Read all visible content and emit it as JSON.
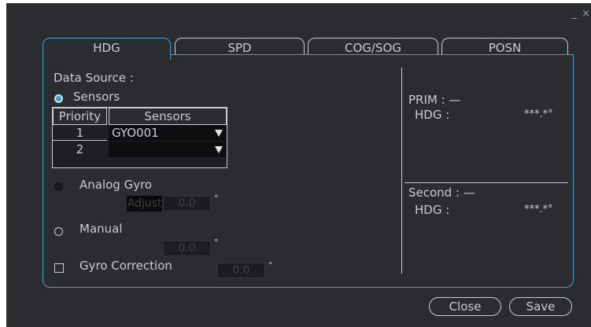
{
  "window": {
    "controls": "_ ×"
  },
  "tabs": [
    {
      "label": "HDG",
      "active": true
    },
    {
      "label": "SPD",
      "active": false
    },
    {
      "label": "COG/SOG",
      "active": false
    },
    {
      "label": "POSN",
      "active": false
    }
  ],
  "data_source": {
    "label": "Data Source :",
    "sensors_option": "Sensors",
    "sensors_selected": true,
    "table": {
      "headers": [
        "Priority",
        "Sensors"
      ],
      "rows": [
        {
          "priority": "1",
          "sensor": "GYO001"
        },
        {
          "priority": "2",
          "sensor": ""
        }
      ]
    },
    "analog_gyro": {
      "label": "Analog Gyro",
      "adjust_label": "Adjust",
      "value": "0.0",
      "unit": "°"
    },
    "manual": {
      "label": "Manual",
      "value": "0.0",
      "unit": "°"
    },
    "gyro_correction": {
      "label": "Gyro Correction",
      "value": "0.0",
      "unit": "°",
      "checked": false
    }
  },
  "status": {
    "prim": {
      "label": "PRIM : —",
      "hdg_label": "HDG :",
      "hdg_value": "***.*°"
    },
    "second": {
      "label": "Second : —",
      "hdg_label": "HDG :",
      "hdg_value": "***.*°"
    }
  },
  "buttons": {
    "close": "Close",
    "save": "Save"
  },
  "colors": {
    "accent": "#3aa6c4",
    "background": "#2a2c30",
    "text": "#c8ccd0"
  }
}
